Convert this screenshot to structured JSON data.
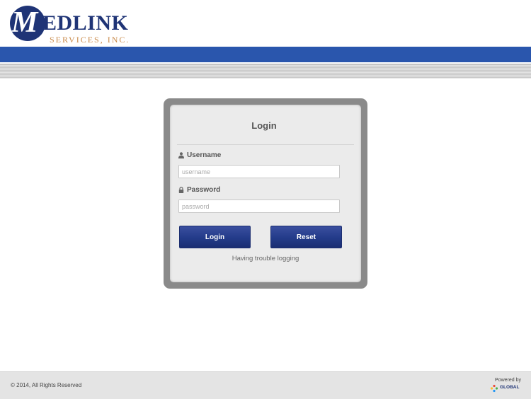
{
  "header": {
    "logo_word": "EDLINK",
    "logo_letter": "M",
    "logo_sub": "SERVICES, INC."
  },
  "login": {
    "title": "Login",
    "username_label": "Username",
    "username_placeholder": "username",
    "password_label": "Password",
    "password_placeholder": "password",
    "login_button": "Login",
    "reset_button": "Reset",
    "trouble_link": "Having trouble logging"
  },
  "footer": {
    "copyright": "© 2014, All Rights Reserved",
    "powered_by": "Powered by",
    "global_logo_text": "GLOBAL"
  },
  "colors": {
    "brand_navy": "#1f3476",
    "blue_bar": "#2a56ad",
    "accent_tan": "#c98a4a",
    "button_blue": "#233b89"
  }
}
